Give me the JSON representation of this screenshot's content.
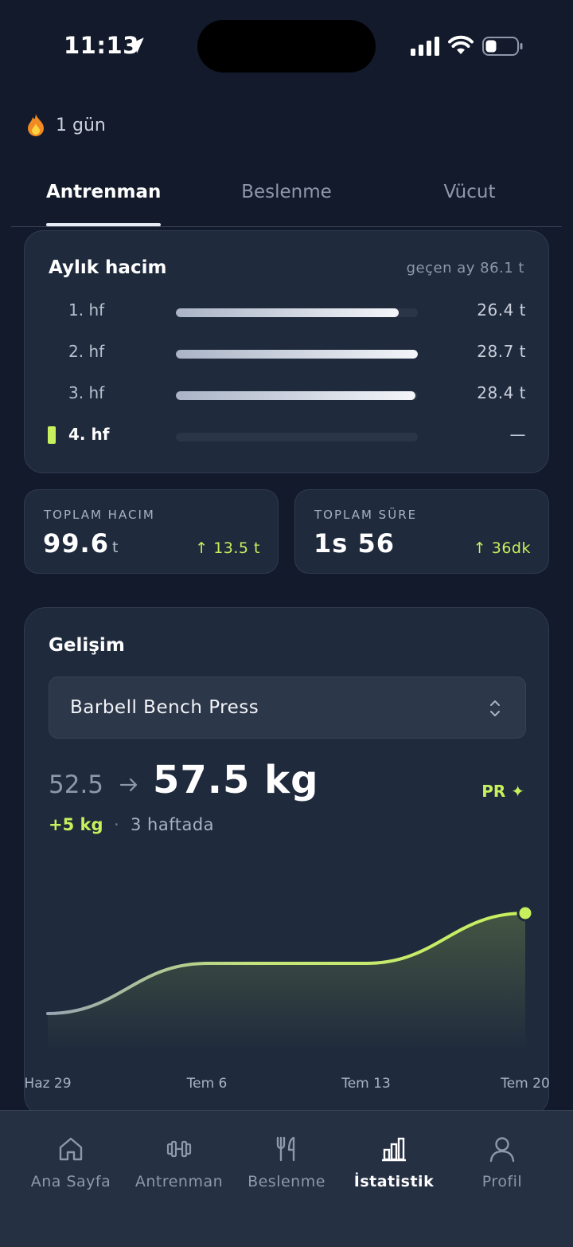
{
  "status_bar": {
    "time": "11:13"
  },
  "streak": {
    "label": "1 gün",
    "icon": "fire-icon"
  },
  "tabs": [
    {
      "label": "Antrenman",
      "active": true
    },
    {
      "label": "Beslenme",
      "active": false
    },
    {
      "label": "Vücut",
      "active": false
    }
  ],
  "monthly_volume": {
    "title": "Aylık hacim",
    "previous": "geçen ay 86.1 t",
    "weeks": [
      {
        "label": "1. hf",
        "value": "26.4 t",
        "fill": 0.92,
        "current": false
      },
      {
        "label": "2. hf",
        "value": "28.7 t",
        "fill": 1.0,
        "current": false
      },
      {
        "label": "3. hf",
        "value": "28.4 t",
        "fill": 0.99,
        "current": false
      },
      {
        "label": "4. hf",
        "value": "—",
        "fill": 0.0,
        "current": true
      }
    ],
    "accent": "#c6f15c"
  },
  "stats": {
    "total_volume": {
      "label": "TOPLAM HACIM",
      "value": "99.6",
      "unit": "t",
      "delta": "↑ 13.5 t"
    },
    "total_time": {
      "label": "TOPLAM SÜRE",
      "value": "1s 56",
      "delta": "↑ 36dk"
    }
  },
  "progress": {
    "title": "Gelişim",
    "exercise": "Barbell Bench Press",
    "from": "52.5",
    "to": "57.5 kg",
    "badge": "PR ✦",
    "gain": "+5 kg",
    "separator": "·",
    "gain_period": "3 haftada"
  },
  "chart_data": {
    "type": "line",
    "x": [
      "Haz 29",
      "Tem 6",
      "Tem 13",
      "Tem 20"
    ],
    "series": [
      {
        "values": [
          52.5,
          55.0,
          55.0,
          57.5
        ]
      }
    ],
    "xlabel": "",
    "ylabel": "",
    "grid": false,
    "highlight_last_point": true
  },
  "bottom_nav": [
    {
      "label": "Ana Sayfa",
      "icon": "home-icon",
      "active": false
    },
    {
      "label": "Antrenman",
      "icon": "dumbbell-icon",
      "active": false
    },
    {
      "label": "Beslenme",
      "icon": "fork-knife-icon",
      "active": false
    },
    {
      "label": "İstatistik",
      "icon": "bar-chart-icon",
      "active": true
    },
    {
      "label": "Profil",
      "icon": "user-icon",
      "active": false
    }
  ]
}
